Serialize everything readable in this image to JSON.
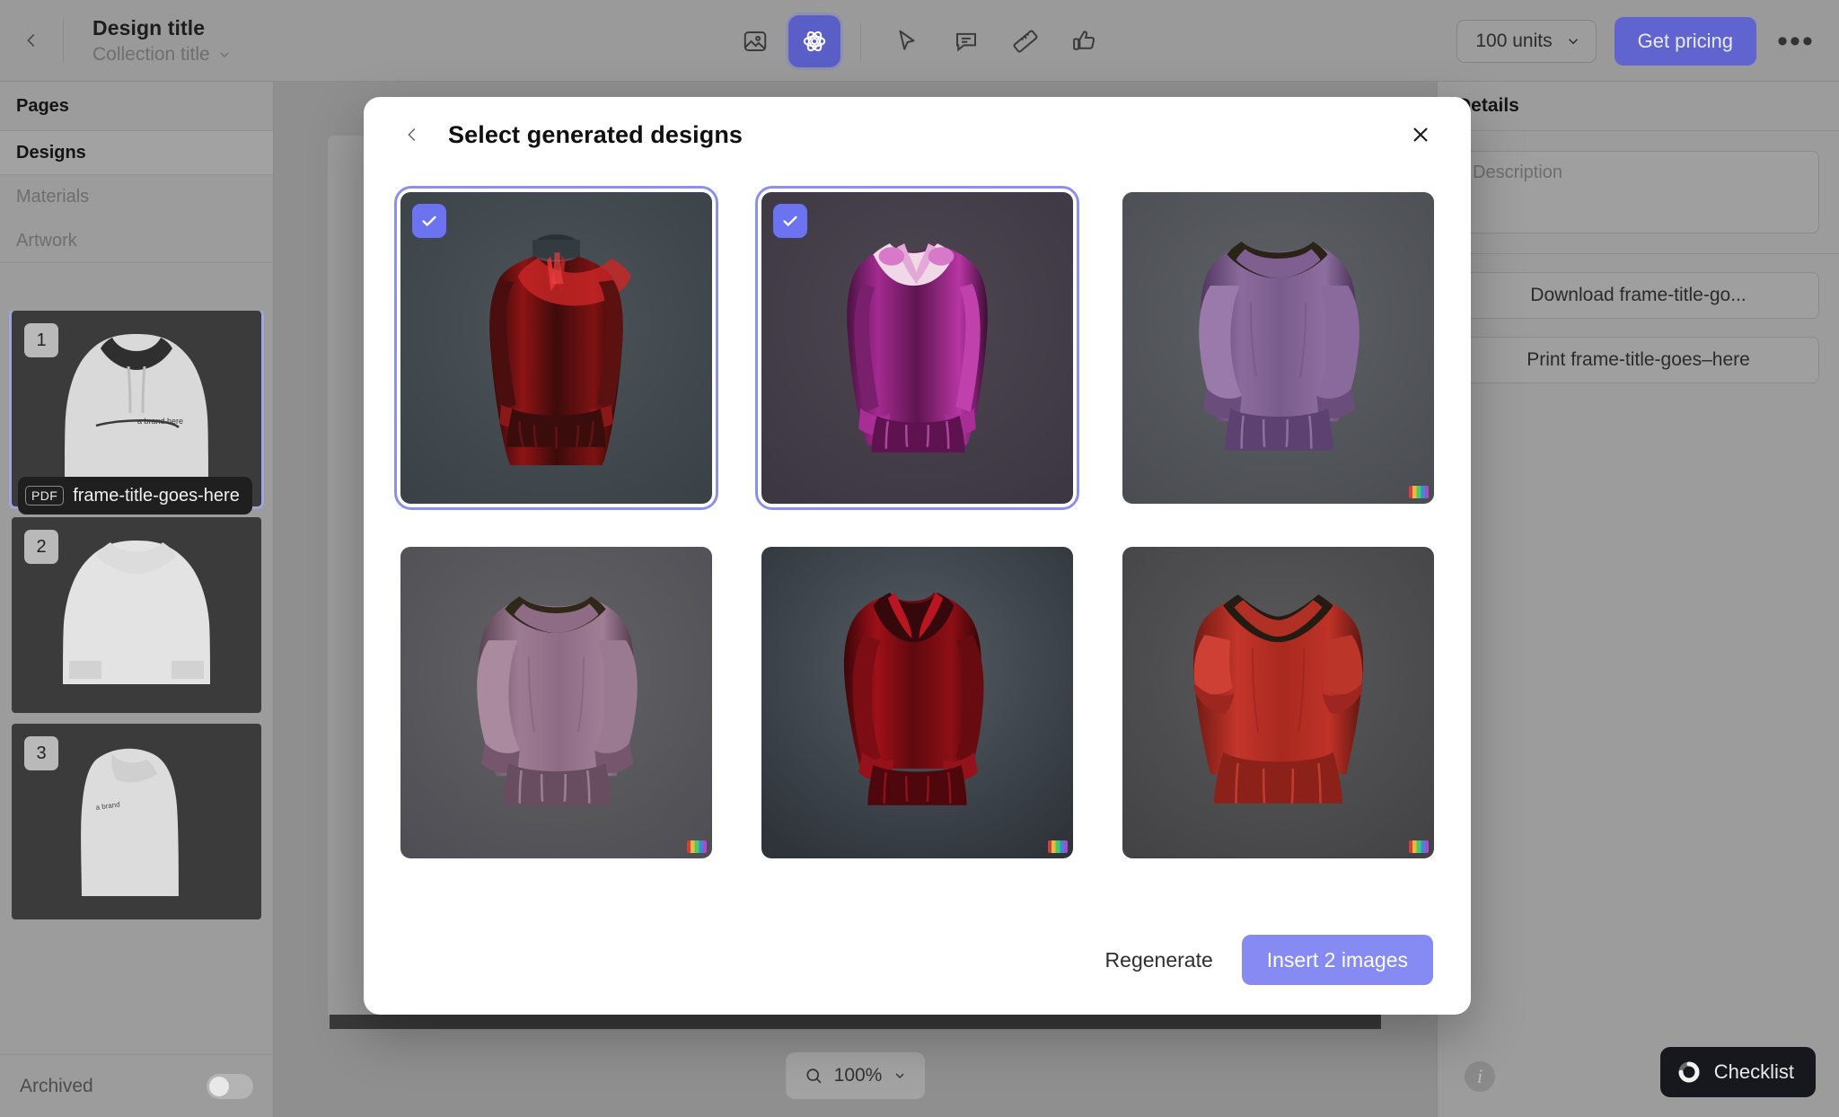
{
  "header": {
    "back_icon": "chevron-left-icon",
    "title": "Design title",
    "subtitle": "Collection title",
    "subtitle_caret": "chevron-down-icon",
    "tools": [
      {
        "name": "image-tool",
        "icon": "image-icon",
        "active": false
      },
      {
        "name": "ai-generate-tool",
        "icon": "atom-icon",
        "active": true
      },
      {
        "name": "select-tool",
        "icon": "cursor-icon",
        "active": false
      },
      {
        "name": "comment-tool",
        "icon": "comment-icon",
        "active": false
      },
      {
        "name": "measure-tool",
        "icon": "ruler-icon",
        "active": false
      },
      {
        "name": "approve-tool",
        "icon": "thumbs-up-icon",
        "active": false
      }
    ],
    "units_value": "100 units",
    "units_caret": "chevron-down-icon",
    "get_pricing_label": "Get pricing",
    "more_icon": "ellipsis-icon"
  },
  "sidebar": {
    "sections": [
      {
        "label": "Pages",
        "style": "head"
      },
      {
        "label": "Designs",
        "style": "selected"
      },
      {
        "label": "Materials",
        "style": "plain"
      },
      {
        "label": "Artwork",
        "style": "plain"
      }
    ],
    "thumbnails": [
      {
        "number": "1",
        "view": "front",
        "active": true
      },
      {
        "number": "2",
        "view": "back",
        "active": false
      },
      {
        "number": "3",
        "view": "side",
        "active": false
      }
    ],
    "pdf_badge": {
      "tag": "PDF",
      "label": "frame-title-goes-here"
    },
    "archived_label": "Archived",
    "archived_on": false
  },
  "right_panel": {
    "title": "Details",
    "description_placeholder": "Description",
    "buttons": [
      {
        "label": "Download frame-title-go..."
      },
      {
        "label": "Print frame-title-goes–here"
      }
    ],
    "info_icon": "info-icon",
    "info_glyph": "i"
  },
  "canvas": {
    "zoom_icon": "search-icon",
    "zoom_level": "100%",
    "zoom_caret": "chevron-down-icon",
    "checklist_label": "Checklist",
    "checklist_icon": "progress-ring-icon"
  },
  "modal": {
    "back_icon": "chevron-left-icon",
    "title": "Select generated designs",
    "close_icon": "close-icon",
    "regenerate_label": "Regenerate",
    "insert_label": "Insert 2 images",
    "check_icon": "check-icon",
    "watermark_icon": "ai-watermark-icon",
    "cards": [
      {
        "id": "design-1",
        "selected": true,
        "garment": "red-velvet-tie-neck-top",
        "watermark": false
      },
      {
        "id": "design-2",
        "selected": true,
        "garment": "magenta-velvet-vneck-top",
        "watermark": false
      },
      {
        "id": "design-3",
        "selected": false,
        "garment": "purple-puff-sleeve-top",
        "watermark": true
      },
      {
        "id": "design-4",
        "selected": false,
        "garment": "mauve-puff-sleeve-peplum",
        "watermark": true
      },
      {
        "id": "design-5",
        "selected": false,
        "garment": "dark-red-velvet-vneck-dress",
        "watermark": true
      },
      {
        "id": "design-6",
        "selected": false,
        "garment": "red-flutter-sleeve-peplum",
        "watermark": true
      }
    ]
  },
  "colors": {
    "accent": "#5f64cf",
    "accent_soft": "#858bf2",
    "checkbox": "#6b73f0",
    "selected_border": "#8b90ef",
    "app_bg": "#909090",
    "panel_bg": "#9c9c9c",
    "dark": "#16181d"
  }
}
